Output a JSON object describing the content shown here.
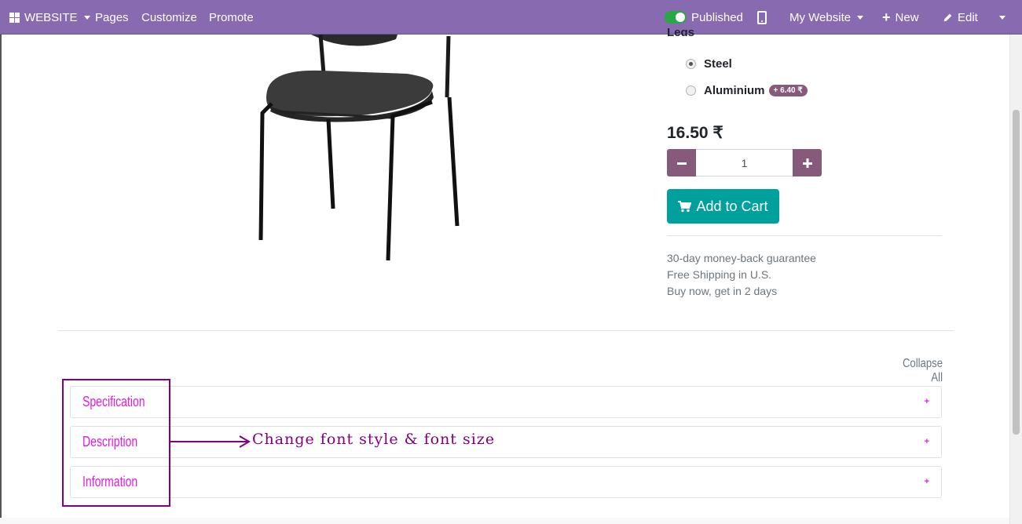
{
  "navbar": {
    "website_label": "WEBSITE",
    "pages_label": "Pages",
    "customize_label": "Customize",
    "promote_label": "Promote",
    "published_label": "Published",
    "my_website_label": "My Website",
    "new_label": "New",
    "edit_label": "Edit"
  },
  "product": {
    "attribute_title": "Legs",
    "options": [
      {
        "label": "Steel",
        "checked": true
      },
      {
        "label": "Aluminium",
        "extra_price": "+ 6.40 ₹",
        "checked": false
      }
    ],
    "price": "16.50 ₹",
    "quantity": "1",
    "add_to_cart_label": "Add to Cart",
    "info_lines": [
      "30-day money-back guarantee",
      "Free Shipping in U.S.",
      "Buy now, get in 2 days"
    ]
  },
  "accordion": {
    "collapse_all_label": "Collapse All",
    "sections": [
      {
        "title": "Specification",
        "icon": "+"
      },
      {
        "title": "Description",
        "icon": "+"
      },
      {
        "title": "Information",
        "icon": "+"
      }
    ]
  },
  "annotation": {
    "text": "Change font style & font size"
  },
  "colors": {
    "navbar": "#876aaf",
    "brand_purple": "#875a7b",
    "add_to_cart": "#00a09d",
    "accordion_title": "#e01ce0",
    "annotation": "#800080"
  },
  "icons": [
    "apps-grid-icon",
    "caret-down-icon",
    "toggle-icon",
    "mobile-phone-icon",
    "plus-icon",
    "pencil-icon",
    "minus-icon",
    "cart-icon"
  ]
}
